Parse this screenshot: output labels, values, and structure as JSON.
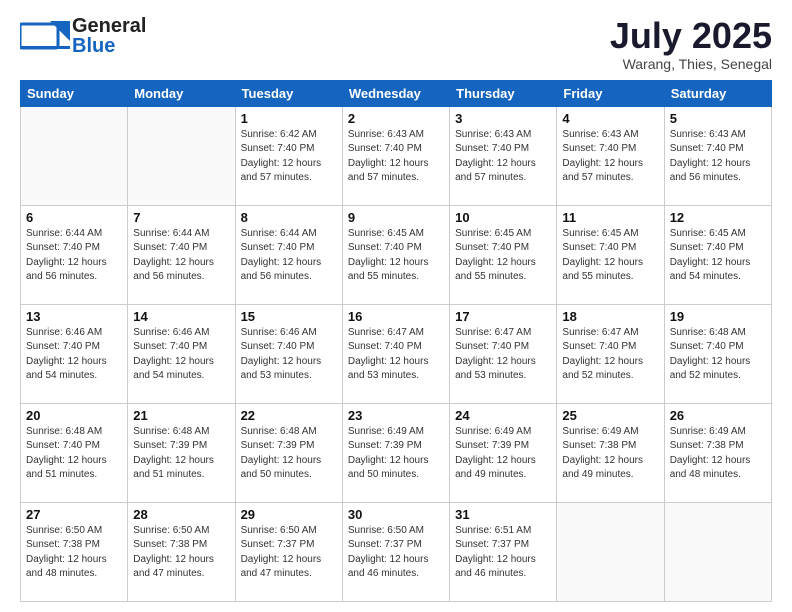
{
  "header": {
    "logo_general": "General",
    "logo_blue": "Blue",
    "title": "July 2025",
    "subtitle": "Warang, Thies, Senegal"
  },
  "calendar": {
    "days_of_week": [
      "Sunday",
      "Monday",
      "Tuesday",
      "Wednesday",
      "Thursday",
      "Friday",
      "Saturday"
    ],
    "weeks": [
      [
        {
          "day": "",
          "info": ""
        },
        {
          "day": "",
          "info": ""
        },
        {
          "day": "1",
          "info": "Sunrise: 6:42 AM\nSunset: 7:40 PM\nDaylight: 12 hours\nand 57 minutes."
        },
        {
          "day": "2",
          "info": "Sunrise: 6:43 AM\nSunset: 7:40 PM\nDaylight: 12 hours\nand 57 minutes."
        },
        {
          "day": "3",
          "info": "Sunrise: 6:43 AM\nSunset: 7:40 PM\nDaylight: 12 hours\nand 57 minutes."
        },
        {
          "day": "4",
          "info": "Sunrise: 6:43 AM\nSunset: 7:40 PM\nDaylight: 12 hours\nand 57 minutes."
        },
        {
          "day": "5",
          "info": "Sunrise: 6:43 AM\nSunset: 7:40 PM\nDaylight: 12 hours\nand 56 minutes."
        }
      ],
      [
        {
          "day": "6",
          "info": "Sunrise: 6:44 AM\nSunset: 7:40 PM\nDaylight: 12 hours\nand 56 minutes."
        },
        {
          "day": "7",
          "info": "Sunrise: 6:44 AM\nSunset: 7:40 PM\nDaylight: 12 hours\nand 56 minutes."
        },
        {
          "day": "8",
          "info": "Sunrise: 6:44 AM\nSunset: 7:40 PM\nDaylight: 12 hours\nand 56 minutes."
        },
        {
          "day": "9",
          "info": "Sunrise: 6:45 AM\nSunset: 7:40 PM\nDaylight: 12 hours\nand 55 minutes."
        },
        {
          "day": "10",
          "info": "Sunrise: 6:45 AM\nSunset: 7:40 PM\nDaylight: 12 hours\nand 55 minutes."
        },
        {
          "day": "11",
          "info": "Sunrise: 6:45 AM\nSunset: 7:40 PM\nDaylight: 12 hours\nand 55 minutes."
        },
        {
          "day": "12",
          "info": "Sunrise: 6:45 AM\nSunset: 7:40 PM\nDaylight: 12 hours\nand 54 minutes."
        }
      ],
      [
        {
          "day": "13",
          "info": "Sunrise: 6:46 AM\nSunset: 7:40 PM\nDaylight: 12 hours\nand 54 minutes."
        },
        {
          "day": "14",
          "info": "Sunrise: 6:46 AM\nSunset: 7:40 PM\nDaylight: 12 hours\nand 54 minutes."
        },
        {
          "day": "15",
          "info": "Sunrise: 6:46 AM\nSunset: 7:40 PM\nDaylight: 12 hours\nand 53 minutes."
        },
        {
          "day": "16",
          "info": "Sunrise: 6:47 AM\nSunset: 7:40 PM\nDaylight: 12 hours\nand 53 minutes."
        },
        {
          "day": "17",
          "info": "Sunrise: 6:47 AM\nSunset: 7:40 PM\nDaylight: 12 hours\nand 53 minutes."
        },
        {
          "day": "18",
          "info": "Sunrise: 6:47 AM\nSunset: 7:40 PM\nDaylight: 12 hours\nand 52 minutes."
        },
        {
          "day": "19",
          "info": "Sunrise: 6:48 AM\nSunset: 7:40 PM\nDaylight: 12 hours\nand 52 minutes."
        }
      ],
      [
        {
          "day": "20",
          "info": "Sunrise: 6:48 AM\nSunset: 7:40 PM\nDaylight: 12 hours\nand 51 minutes."
        },
        {
          "day": "21",
          "info": "Sunrise: 6:48 AM\nSunset: 7:39 PM\nDaylight: 12 hours\nand 51 minutes."
        },
        {
          "day": "22",
          "info": "Sunrise: 6:48 AM\nSunset: 7:39 PM\nDaylight: 12 hours\nand 50 minutes."
        },
        {
          "day": "23",
          "info": "Sunrise: 6:49 AM\nSunset: 7:39 PM\nDaylight: 12 hours\nand 50 minutes."
        },
        {
          "day": "24",
          "info": "Sunrise: 6:49 AM\nSunset: 7:39 PM\nDaylight: 12 hours\nand 49 minutes."
        },
        {
          "day": "25",
          "info": "Sunrise: 6:49 AM\nSunset: 7:38 PM\nDaylight: 12 hours\nand 49 minutes."
        },
        {
          "day": "26",
          "info": "Sunrise: 6:49 AM\nSunset: 7:38 PM\nDaylight: 12 hours\nand 48 minutes."
        }
      ],
      [
        {
          "day": "27",
          "info": "Sunrise: 6:50 AM\nSunset: 7:38 PM\nDaylight: 12 hours\nand 48 minutes."
        },
        {
          "day": "28",
          "info": "Sunrise: 6:50 AM\nSunset: 7:38 PM\nDaylight: 12 hours\nand 47 minutes."
        },
        {
          "day": "29",
          "info": "Sunrise: 6:50 AM\nSunset: 7:37 PM\nDaylight: 12 hours\nand 47 minutes."
        },
        {
          "day": "30",
          "info": "Sunrise: 6:50 AM\nSunset: 7:37 PM\nDaylight: 12 hours\nand 46 minutes."
        },
        {
          "day": "31",
          "info": "Sunrise: 6:51 AM\nSunset: 7:37 PM\nDaylight: 12 hours\nand 46 minutes."
        },
        {
          "day": "",
          "info": ""
        },
        {
          "day": "",
          "info": ""
        }
      ]
    ]
  }
}
